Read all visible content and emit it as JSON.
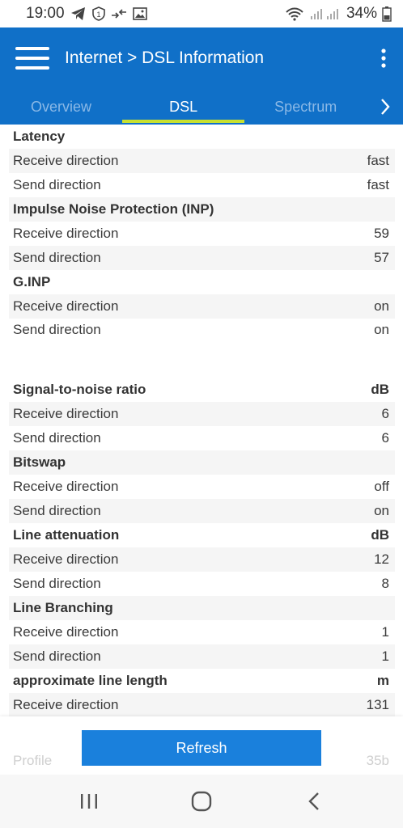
{
  "status_bar": {
    "time": "19:00",
    "battery": "34%"
  },
  "app_bar": {
    "title": "Internet > DSL Information"
  },
  "tabs": [
    {
      "label": "Overview",
      "active": false
    },
    {
      "label": "DSL",
      "active": true
    },
    {
      "label": "Spectrum",
      "active": false
    }
  ],
  "rows": [
    {
      "label": "Latency",
      "value": "",
      "header": true
    },
    {
      "label": "Receive direction",
      "value": "fast"
    },
    {
      "label": "Send direction",
      "value": "fast"
    },
    {
      "label": "Impulse Noise Protection (INP)",
      "value": "",
      "header": true
    },
    {
      "label": "Receive direction",
      "value": "59"
    },
    {
      "label": "Send direction",
      "value": "57"
    },
    {
      "label": "G.INP",
      "value": "",
      "header": true
    },
    {
      "label": "Receive direction",
      "value": "on"
    },
    {
      "label": "Send direction",
      "value": "on"
    },
    {
      "label": "",
      "value": "",
      "blank": true
    },
    {
      "label": "Signal-to-noise ratio",
      "value": "dB",
      "header": true
    },
    {
      "label": "Receive direction",
      "value": "6"
    },
    {
      "label": "Send direction",
      "value": "6"
    },
    {
      "label": "Bitswap",
      "value": "",
      "header": true
    },
    {
      "label": "Receive direction",
      "value": "off"
    },
    {
      "label": "Send direction",
      "value": "on"
    },
    {
      "label": "Line attenuation",
      "value": "dB",
      "header": true
    },
    {
      "label": "Receive direction",
      "value": "12"
    },
    {
      "label": "Send direction",
      "value": "8"
    },
    {
      "label": "Line Branching",
      "value": "",
      "header": true
    },
    {
      "label": "Receive direction",
      "value": "1"
    },
    {
      "label": "Send direction",
      "value": "1"
    },
    {
      "label": "approximate line length",
      "value": "m",
      "header": true
    },
    {
      "label": "Receive direction",
      "value": "131"
    }
  ],
  "profile_row": {
    "label": "Profile",
    "value": "35b"
  },
  "refresh_label": "Refresh",
  "colors": {
    "app_bar": "#1070c8",
    "tab_indicator": "#c8e030",
    "refresh_button": "#1a80dc"
  }
}
